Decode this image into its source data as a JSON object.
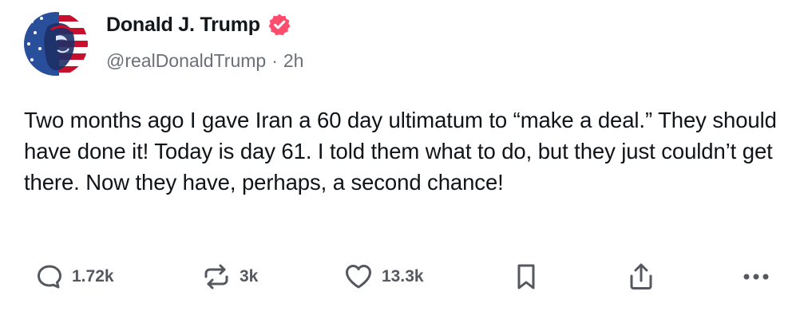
{
  "author": {
    "display_name": "Donald J. Trump",
    "handle": "@realDonaldTrump",
    "separator": "·",
    "time_ago": "2h",
    "verified": true,
    "verified_color": "#ff4d6d"
  },
  "post": {
    "text": "Two months ago I gave Iran a 60 day ultimatum to “make a deal.” They should have done it! Today is day 61. I told them what to do, but they just couldn’t get there. Now they have, perhaps, a second chance!"
  },
  "actions": {
    "replies": "1.72k",
    "reposts": "3k",
    "likes": "13.3k"
  },
  "icons": {
    "reply": "reply-bubble-icon",
    "repost": "repost-icon",
    "like": "heart-icon",
    "bookmark": "bookmark-icon",
    "share": "share-icon",
    "more": "more-dots-icon"
  }
}
